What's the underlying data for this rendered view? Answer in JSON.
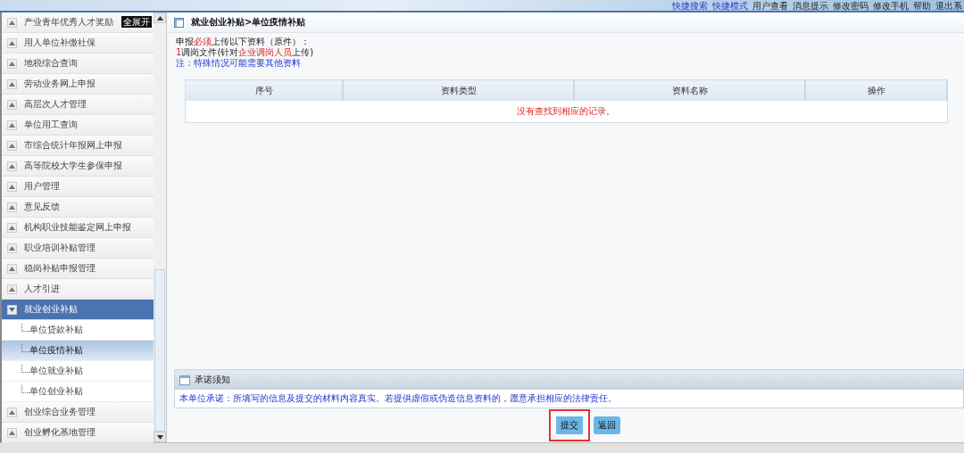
{
  "header": {
    "links": [
      {
        "label": "快捷搜索",
        "kind": "quick"
      },
      {
        "label": "快捷模式",
        "kind": "quick"
      },
      {
        "label": "用户查看",
        "kind": "normal"
      },
      {
        "label": "消息提示",
        "kind": "normal"
      },
      {
        "label": "修改密码",
        "kind": "normal"
      },
      {
        "label": "修改手机",
        "kind": "normal"
      },
      {
        "label": "帮助",
        "kind": "normal"
      },
      {
        "label": "退出系",
        "kind": "normal"
      }
    ]
  },
  "sidebar": {
    "expand_all_button": "全展开",
    "items": [
      {
        "label": "产业青年优秀人才奖励",
        "expanded": false
      },
      {
        "label": "用人单位补缴社保",
        "expanded": false
      },
      {
        "label": "地税综合查询",
        "expanded": false
      },
      {
        "label": "劳动业务网上申报",
        "expanded": false
      },
      {
        "label": "高层次人才管理",
        "expanded": false
      },
      {
        "label": "单位用工查询",
        "expanded": false
      },
      {
        "label": "市综合统计年报网上申报",
        "expanded": false
      },
      {
        "label": "高等院校大学生参保申报",
        "expanded": false
      },
      {
        "label": "用户管理",
        "expanded": false
      },
      {
        "label": "意见反馈",
        "expanded": false
      },
      {
        "label": "机构职业技能鉴定网上申报",
        "expanded": false
      },
      {
        "label": "职业培训补贴管理",
        "expanded": false
      },
      {
        "label": "稳岗补贴申报管理",
        "expanded": false
      },
      {
        "label": "人才引进",
        "expanded": false
      },
      {
        "label": "就业创业补贴",
        "expanded": true,
        "children": [
          {
            "label": "单位贷款补贴",
            "selected": false
          },
          {
            "label": "单位疫情补贴",
            "selected": true
          },
          {
            "label": "单位就业补贴",
            "selected": false
          },
          {
            "label": "单位创业补贴",
            "selected": false
          }
        ]
      },
      {
        "label": "创业综合业务管理",
        "expanded": false
      },
      {
        "label": "创业孵化基地管理",
        "expanded": false
      }
    ]
  },
  "panel": {
    "title": "就业创业补贴>单位疫情补贴",
    "requirements": [
      {
        "kind": "plain",
        "parts": [
          {
            "text": "申报",
            "highlight": false
          },
          {
            "text": "必须",
            "highlight": true
          },
          {
            "text": "上传以下资料（原件）：",
            "highlight": false
          }
        ]
      },
      {
        "kind": "plain",
        "parts": [
          {
            "text": "1",
            "highlight": true
          },
          {
            "text": "调岗文件(针对",
            "highlight": false
          },
          {
            "text": "企业调岗人员",
            "highlight": true
          },
          {
            "text": "上传)",
            "highlight": false
          }
        ]
      },
      {
        "kind": "note",
        "parts": [
          {
            "text": "注：特殊情况可能需要其他资料",
            "highlight": false
          }
        ]
      }
    ],
    "table": {
      "columns": [
        "序号",
        "资料类型",
        "资料名称",
        "操作"
      ],
      "empty_message": "没有查找到相应的记录。"
    },
    "notice": {
      "title": "承诺须知",
      "text": "本单位承诺：所填写的信息及提交的材料内容真实。若提供虚假或伪造信息资料的，愿意承担相应的法律责任。"
    },
    "buttons": [
      {
        "label": "提交",
        "highlighted": true
      },
      {
        "label": "返回",
        "highlighted": false
      }
    ]
  }
}
